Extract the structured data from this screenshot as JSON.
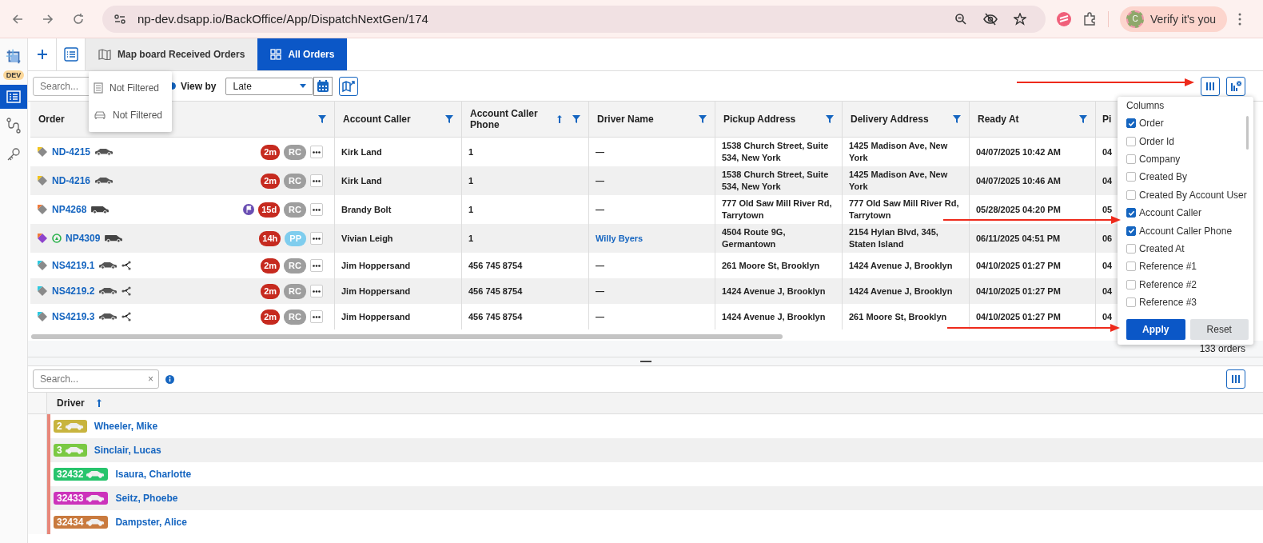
{
  "browser": {
    "url": "np-dev.dsapp.io/BackOffice/App/DispatchNextGen/174",
    "profile_initial": "C",
    "profile_label": "Verify it's you"
  },
  "sidebar": {
    "env_badge": "DEV",
    "items": [
      {
        "kind": "orders",
        "selected": true
      },
      {
        "kind": "route",
        "selected": false
      },
      {
        "kind": "key",
        "selected": false
      }
    ]
  },
  "tabs": [
    {
      "kind": "map",
      "label": "Map board Received Orders",
      "selected": false
    },
    {
      "kind": "grid",
      "label": "All Orders",
      "selected": true
    }
  ],
  "filter_popup": {
    "items": [
      {
        "kind": "list",
        "label": "Not Filtered"
      },
      {
        "kind": "car",
        "label": "Not Filtered"
      }
    ]
  },
  "toolbar": {
    "search_placeholder": "Search...",
    "view_by": {
      "label": "View by",
      "selected": true
    },
    "view_by_value": "Late"
  },
  "orders_table": {
    "columns": [
      {
        "label": "Order",
        "sorted": false,
        "filter": true
      },
      {
        "label": "Account Caller",
        "sorted": false,
        "filter": true
      },
      {
        "label": "Account Caller Phone",
        "sorted": true,
        "filter": true
      },
      {
        "label": "Driver Name",
        "sorted": false,
        "filter": true
      },
      {
        "label": "Pickup Address",
        "sorted": false,
        "filter": true
      },
      {
        "label": "Delivery Address",
        "sorted": false,
        "filter": true
      },
      {
        "label": "Ready At",
        "sorted": false,
        "filter": true
      },
      {
        "label": "Pi"
      }
    ],
    "rows": [
      {
        "order": "ND-4215",
        "tag": {
          "color": "#8a8a8a"
        },
        "tag_corner": {
          "color": "#f2c31b"
        },
        "marker": false,
        "vehicle": {
          "kind": "car"
        },
        "split": false,
        "flag": false,
        "age": "2m",
        "status": {
          "label": "RC",
          "color": "#9e9e9e"
        },
        "account_caller": "Kirk Land",
        "phone": "1",
        "driver": "—",
        "driver_assigned": false,
        "pickup": "1538 Church Street, Suite 534, New York",
        "delivery": "1425 Madison Ave, New York",
        "ready_at": "04/07/2025 10:42 AM",
        "column_8": "04"
      },
      {
        "order": "ND-4216",
        "tag": {
          "color": "#8a8a8a"
        },
        "tag_corner": {
          "color": "#f2c31b"
        },
        "marker": false,
        "vehicle": {
          "kind": "car"
        },
        "split": false,
        "flag": false,
        "age": "2m",
        "status": {
          "label": "RC",
          "color": "#9e9e9e"
        },
        "account_caller": "Kirk Land",
        "phone": "1",
        "driver": "—",
        "driver_assigned": false,
        "pickup": "1538 Church Street, Suite 534, New York",
        "delivery": "1425 Madison Ave, New York",
        "ready_at": "04/07/2025 10:46 AM",
        "column_8": "04"
      },
      {
        "order": "NP4268",
        "tag": {
          "color": "#8a8a8a"
        },
        "tag_corner": {
          "color": "#f07a3a"
        },
        "marker": false,
        "vehicle": {
          "kind": "van"
        },
        "split": false,
        "flag": true,
        "age": "15d",
        "status": {
          "label": "RC",
          "color": "#9e9e9e"
        },
        "account_caller": "Brandy Bolt",
        "phone": "1",
        "driver": "—",
        "driver_assigned": false,
        "pickup": "777 Old Saw Mill River Rd, Tarrytown",
        "delivery": "777 Old Saw Mill River Rd, Tarrytown",
        "ready_at": "05/28/2025 04:20 PM",
        "column_8": "05"
      },
      {
        "order": "NP4309",
        "tag": {
          "color": "#8e44cc"
        },
        "tag_corner": {
          "color": "#f07a3a"
        },
        "marker": true,
        "vehicle": {
          "kind": "van"
        },
        "split": false,
        "flag": false,
        "age": "14h",
        "status": {
          "label": "PP",
          "color": "#7fcdee"
        },
        "account_caller": "Vivian Leigh",
        "phone": "1",
        "driver": "Willy Byers",
        "driver_assigned": true,
        "pickup": "4504 Route 9G, Germantown",
        "delivery": "2154 Hylan Blvd, 345, Staten Island",
        "ready_at": "06/11/2025 04:51 PM",
        "column_8": "06"
      },
      {
        "order": "NS4219.1",
        "tag": {
          "color": "#8a8a8a"
        },
        "tag_corner": {
          "color": "#2ec9e0"
        },
        "marker": false,
        "vehicle": {
          "kind": "car"
        },
        "split": true,
        "flag": false,
        "age": "2m",
        "status": {
          "label": "RC",
          "color": "#9e9e9e"
        },
        "account_caller": "Jim Hoppersand",
        "phone": "456 745 8754",
        "driver": "—",
        "driver_assigned": false,
        "pickup": "261 Moore St, Brooklyn",
        "delivery": "1424 Avenue J, Brooklyn",
        "ready_at": "04/10/2025 01:27 PM",
        "column_8": "04"
      },
      {
        "order": "NS4219.2",
        "tag": {
          "color": "#8a8a8a"
        },
        "tag_corner": {
          "color": "#2ec9e0"
        },
        "marker": false,
        "vehicle": {
          "kind": "car"
        },
        "split": true,
        "flag": false,
        "age": "2m",
        "status": {
          "label": "RC",
          "color": "#9e9e9e"
        },
        "account_caller": "Jim Hoppersand",
        "phone": "456 745 8754",
        "driver": "—",
        "driver_assigned": false,
        "pickup": "1424 Avenue J, Brooklyn",
        "delivery": "1424 Avenue J, Brooklyn",
        "ready_at": "04/10/2025 01:27 PM",
        "column_8": "04"
      },
      {
        "order": "NS4219.3",
        "tag": {
          "color": "#8a8a8a"
        },
        "tag_corner": {
          "color": "#2ec9e0"
        },
        "marker": false,
        "vehicle": {
          "kind": "car"
        },
        "split": true,
        "flag": false,
        "age": "2m",
        "status": {
          "label": "RC",
          "color": "#9e9e9e"
        },
        "account_caller": "Jim Hoppersand",
        "phone": "456 745 8754",
        "driver": "—",
        "driver_assigned": false,
        "pickup": "1424 Avenue J, Brooklyn",
        "delivery": "261 Moore St, Brooklyn",
        "ready_at": "04/10/2025 01:27 PM",
        "column_8": "04"
      }
    ],
    "status_text": "133 orders"
  },
  "column_panel": {
    "title": "Columns",
    "options": [
      {
        "label": "Order",
        "checked": true
      },
      {
        "label": "Order Id",
        "checked": false
      },
      {
        "label": "Company",
        "checked": false
      },
      {
        "label": "Created By",
        "checked": false
      },
      {
        "label": "Created By Account User",
        "checked": false
      },
      {
        "label": "Account Caller",
        "checked": true
      },
      {
        "label": "Account Caller Phone",
        "checked": true
      },
      {
        "label": "Created At",
        "checked": false
      },
      {
        "label": "Reference #1",
        "checked": false
      },
      {
        "label": "Reference #2",
        "checked": false
      },
      {
        "label": "Reference #3",
        "checked": false
      }
    ],
    "apply": "Apply",
    "reset": "Reset"
  },
  "drivers_panel": {
    "search_placeholder": "Search...",
    "clear": "×",
    "column": {
      "label": "Driver",
      "sorted": true
    },
    "rows": [
      {
        "number": "2",
        "color": "#c8b43e",
        "name": "Wheeler, Mike"
      },
      {
        "number": "3",
        "color": "#7ac943",
        "name": "Sinclair, Lucas"
      },
      {
        "number": "32432",
        "color": "#27c46c",
        "name": "Isaura, Charlotte"
      },
      {
        "number": "32433",
        "color": "#cc33bb",
        "name": "Seitz, Phoebe"
      },
      {
        "number": "32434",
        "color": "#c97a3e",
        "name": "Dampster, Alice"
      }
    ]
  }
}
